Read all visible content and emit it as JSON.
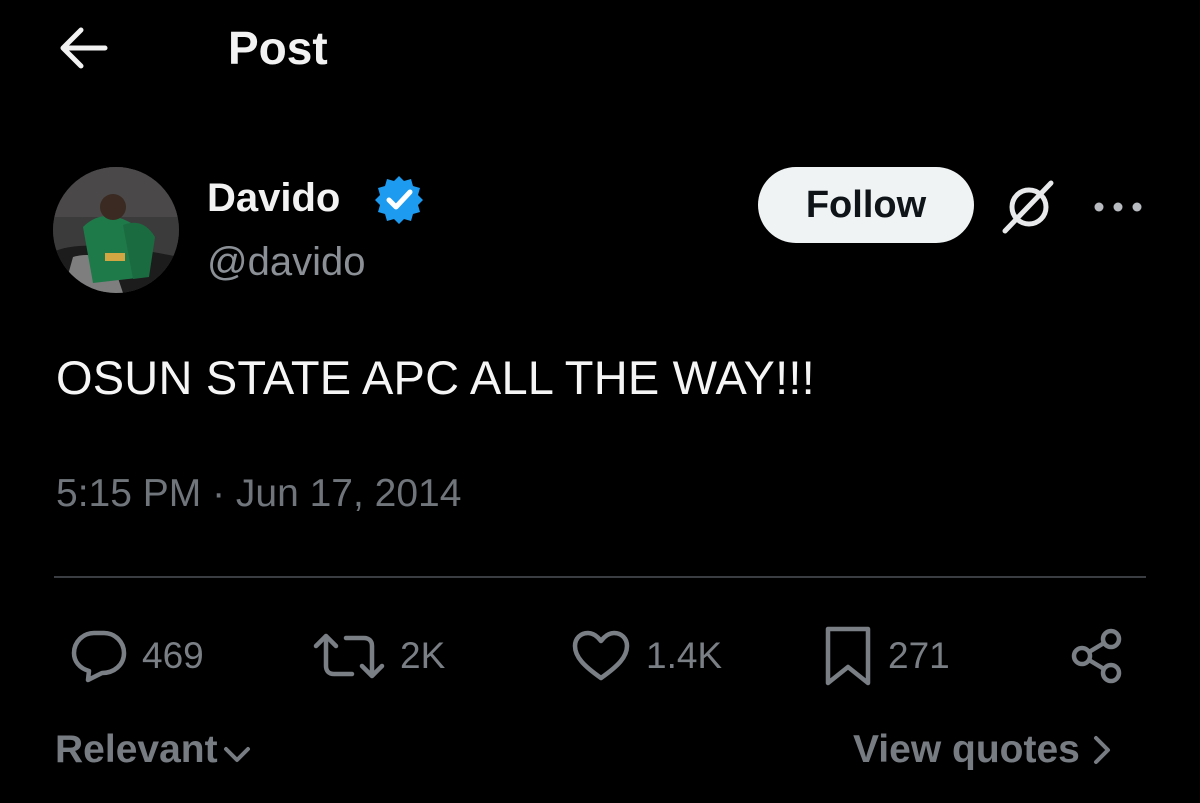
{
  "header": {
    "back_icon": "arrow-left-icon",
    "title": "Post"
  },
  "author": {
    "name": "Davido",
    "handle": "@davido",
    "verified_icon": "verified-badge-icon",
    "verified_color": "#1d9bf0"
  },
  "actions_top": {
    "follow_label": "Follow",
    "grok_icon": "grok-icon",
    "more_icon": "more-horizontal-icon"
  },
  "post": {
    "text": "OSUN STATE APC ALL THE WAY!!!",
    "timestamp": "5:15 PM · Jun 17, 2014"
  },
  "engagement": {
    "replies": "469",
    "reposts": "2K",
    "likes": "1.4K",
    "bookmarks": "271",
    "icons": [
      "reply-icon",
      "repost-icon",
      "like-icon",
      "bookmark-icon",
      "share-icon"
    ]
  },
  "footer": {
    "sort_label": "Relevant",
    "view_quotes_label": "View quotes"
  },
  "colors": {
    "background": "#000000",
    "text_primary": "#e7e9ea",
    "text_secondary": "#71767b",
    "follow_bg": "#eff3f4"
  }
}
